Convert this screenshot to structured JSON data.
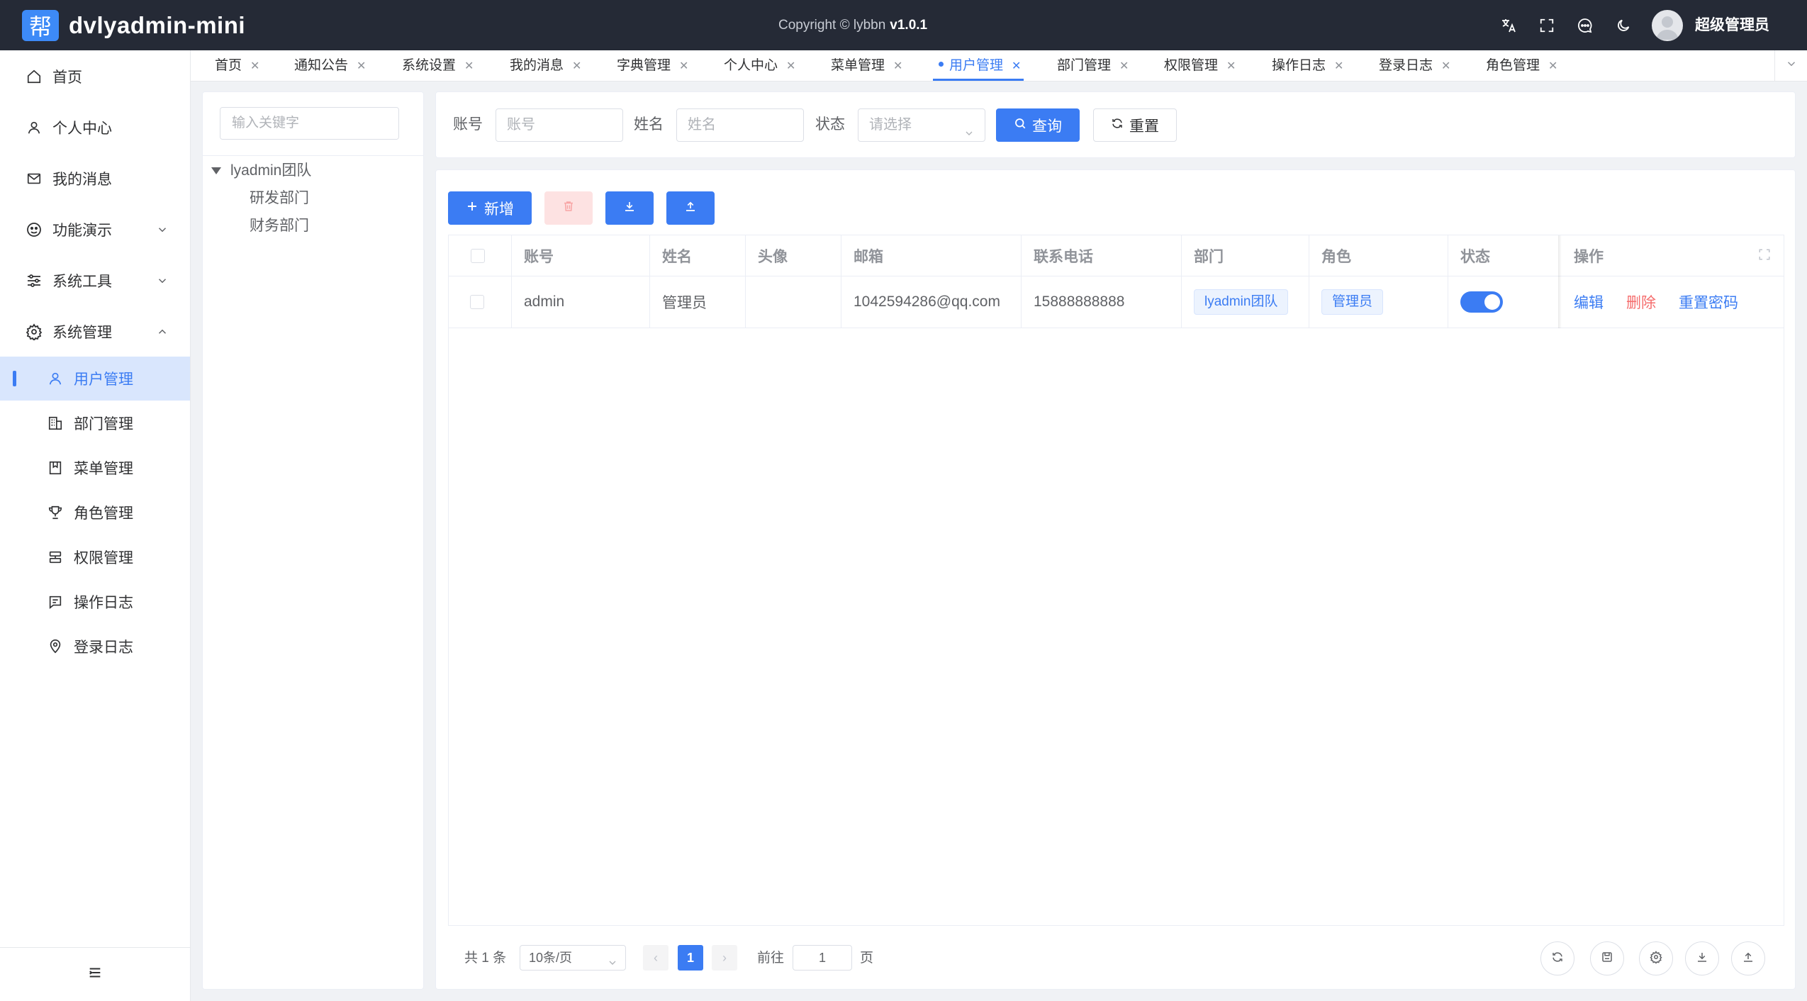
{
  "app": {
    "logo_char": "帮",
    "title": "dvlyadmin-mini",
    "copyright": "Copyright © lybbn",
    "version": "v1.0.1"
  },
  "header": {
    "icons": [
      "translate-icon",
      "fullscreen-icon",
      "message-icon",
      "dark-mode-icon"
    ],
    "user_name": "超级管理员"
  },
  "sidebar": {
    "items": [
      {
        "label": "首页",
        "icon": "home-icon"
      },
      {
        "label": "个人中心",
        "icon": "user-icon"
      },
      {
        "label": "我的消息",
        "icon": "mail-icon"
      },
      {
        "label": "功能演示",
        "icon": "demo-icon",
        "expandable": true,
        "expanded": false
      },
      {
        "label": "系统工具",
        "icon": "tools-icon",
        "expandable": true,
        "expanded": false
      },
      {
        "label": "系统管理",
        "icon": "gear-icon",
        "expandable": true,
        "expanded": true
      }
    ],
    "sub_items": [
      {
        "label": "用户管理",
        "icon": "user-icon",
        "active": true
      },
      {
        "label": "部门管理",
        "icon": "building-icon"
      },
      {
        "label": "菜单管理",
        "icon": "bookmark-icon"
      },
      {
        "label": "角色管理",
        "icon": "trophy-icon"
      },
      {
        "label": "权限管理",
        "icon": "permission-icon"
      },
      {
        "label": "操作日志",
        "icon": "log-icon"
      },
      {
        "label": "登录日志",
        "icon": "location-icon"
      }
    ]
  },
  "tabs": [
    {
      "label": "首页"
    },
    {
      "label": "通知公告"
    },
    {
      "label": "系统设置"
    },
    {
      "label": "我的消息"
    },
    {
      "label": "字典管理"
    },
    {
      "label": "个人中心"
    },
    {
      "label": "菜单管理"
    },
    {
      "label": "用户管理",
      "active": true
    },
    {
      "label": "部门管理"
    },
    {
      "label": "权限管理"
    },
    {
      "label": "操作日志"
    },
    {
      "label": "登录日志"
    },
    {
      "label": "角色管理"
    }
  ],
  "tree": {
    "search_placeholder": "输入关键字",
    "root": "lyadmin团队",
    "children": [
      "研发部门",
      "财务部门"
    ]
  },
  "search_form": {
    "account_label": "账号",
    "account_placeholder": "账号",
    "name_label": "姓名",
    "name_placeholder": "姓名",
    "status_label": "状态",
    "status_placeholder": "请选择",
    "query_button": "查询",
    "reset_button": "重置"
  },
  "toolbar": {
    "add_button": "新增"
  },
  "table": {
    "columns": [
      "账号",
      "姓名",
      "头像",
      "邮箱",
      "联系电话",
      "部门",
      "角色",
      "状态",
      "操作"
    ],
    "rows": [
      {
        "account": "admin",
        "name": "管理员",
        "avatar": "",
        "email": "1042594286@qq.com",
        "phone": "15888888888",
        "dept": "lyadmin团队",
        "role": "管理员",
        "status_on": true,
        "actions": [
          "编辑",
          "删除",
          "重置密码"
        ]
      }
    ]
  },
  "pagination": {
    "total_text": "共 1 条",
    "page_size": "10条/页",
    "current_page": "1",
    "goto_label": "前往",
    "goto_value": "1",
    "page_suffix": "页"
  },
  "colors": {
    "primary": "#3b7cf3",
    "header_bg": "#252a36",
    "danger": "#f56c6c"
  }
}
